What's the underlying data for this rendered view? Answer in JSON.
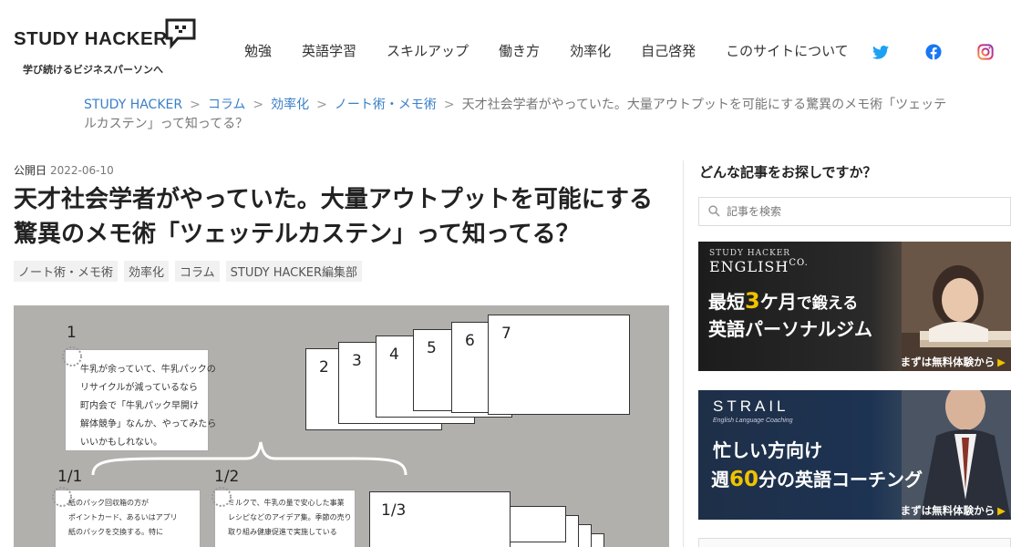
{
  "header": {
    "logo_text": "STUDY HACKER",
    "tagline": "学び続けるビジネスパーソンへ",
    "nav": [
      "勉強",
      "英語学習",
      "スキルアップ",
      "働き方",
      "効率化",
      "自己啓発",
      "このサイトについて"
    ],
    "social": [
      "twitter-icon",
      "facebook-icon",
      "instagram-icon"
    ]
  },
  "breadcrumb": {
    "items": [
      "STUDY HACKER",
      "コラム",
      "効率化",
      "ノート術・メモ術"
    ],
    "current": "天才社会学者がやっていた。大量アウトプットを可能にする驚異のメモ術「ツェッテルカステン」って知ってる？",
    "separator": ">"
  },
  "article": {
    "date_label": "公開日",
    "date": "2022-06-10",
    "title": "天才社会学者がやっていた。大量アウトプットを可能にする驚異のメモ術「ツェッテルカステン」って知ってる？",
    "tags": [
      "ノート術・メモ術",
      "効率化",
      "コラム",
      "STUDY HACKER編集部"
    ],
    "hero": {
      "card_numbers": [
        "2",
        "3",
        "4",
        "5",
        "6",
        "7"
      ],
      "labels": [
        "1",
        "1/1",
        "1/2",
        "1/3"
      ],
      "handwriting_main": [
        "牛乳が余っていて、牛乳パックの",
        "リサイクルが減っているなら",
        "町内会で「牛乳パック早開け",
        "解体競争」なんか、やってみたら",
        "いいかもしれない。"
      ],
      "handwriting_left": [
        "紙のパック回収箱の方が",
        "ポイントカード、あるいはアプリ",
        "紙のパックを交換する。特に"
      ],
      "handwriting_mid": [
        "ミルクで、牛乳の量で安心した事業",
        "レシピなどのアイデア集。季節の売り",
        "取り組み健康促進で実施している"
      ]
    }
  },
  "sidebar": {
    "title": "どんな記事をお探しですか？",
    "search_placeholder": "記事を検索",
    "banner1": {
      "small": "STUDY HACKER",
      "brand": "ENGLISH",
      "brand_suffix": "CO.",
      "line1_a": "最短",
      "line1_hl": "3",
      "line1_b": "ケ月",
      "line1_c": "で鍛える",
      "line2": "英語パーソナルジム",
      "cta": "まずは無料体験から"
    },
    "banner2": {
      "brand": "STRAIL",
      "sub": "English Language Coaching",
      "line1": "忙しい方向け",
      "line2_a": "週",
      "line2_hl": "60",
      "line2_b": "分の英語コーチング",
      "cta": "まずは無料体験から"
    }
  },
  "colors": {
    "link": "#3a7fc8",
    "twitter": "#1da1f2",
    "facebook": "#1877f2",
    "instagram": "#e1306c",
    "banner_accent": "#f0c200"
  }
}
